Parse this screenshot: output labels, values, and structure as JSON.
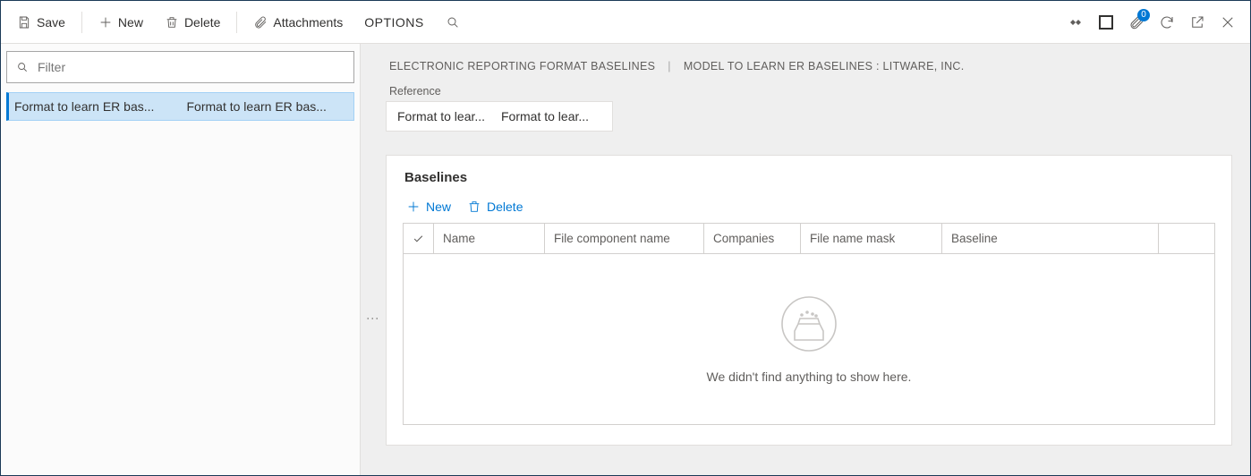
{
  "toolbar": {
    "save": "Save",
    "new": "New",
    "delete": "Delete",
    "attachments": "Attachments",
    "options": "OPTIONS",
    "badge_count": "0"
  },
  "left": {
    "filter_placeholder": "Filter",
    "row": {
      "col1": "Format to learn ER bas...",
      "col2": "Format to learn ER bas..."
    }
  },
  "breadcrumb": {
    "a": "ELECTRONIC REPORTING FORMAT BASELINES",
    "b": "MODEL TO LEARN ER BASELINES : LITWARE, INC."
  },
  "reference": {
    "label": "Reference",
    "col1": "Format to lear...",
    "col2": "Format to lear..."
  },
  "baselines": {
    "title": "Baselines",
    "new": "New",
    "delete": "Delete",
    "columns": {
      "name": "Name",
      "file_component": "File component name",
      "companies": "Companies",
      "file_mask": "File name mask",
      "baseline": "Baseline"
    },
    "empty_text": "We didn't find anything to show here."
  }
}
